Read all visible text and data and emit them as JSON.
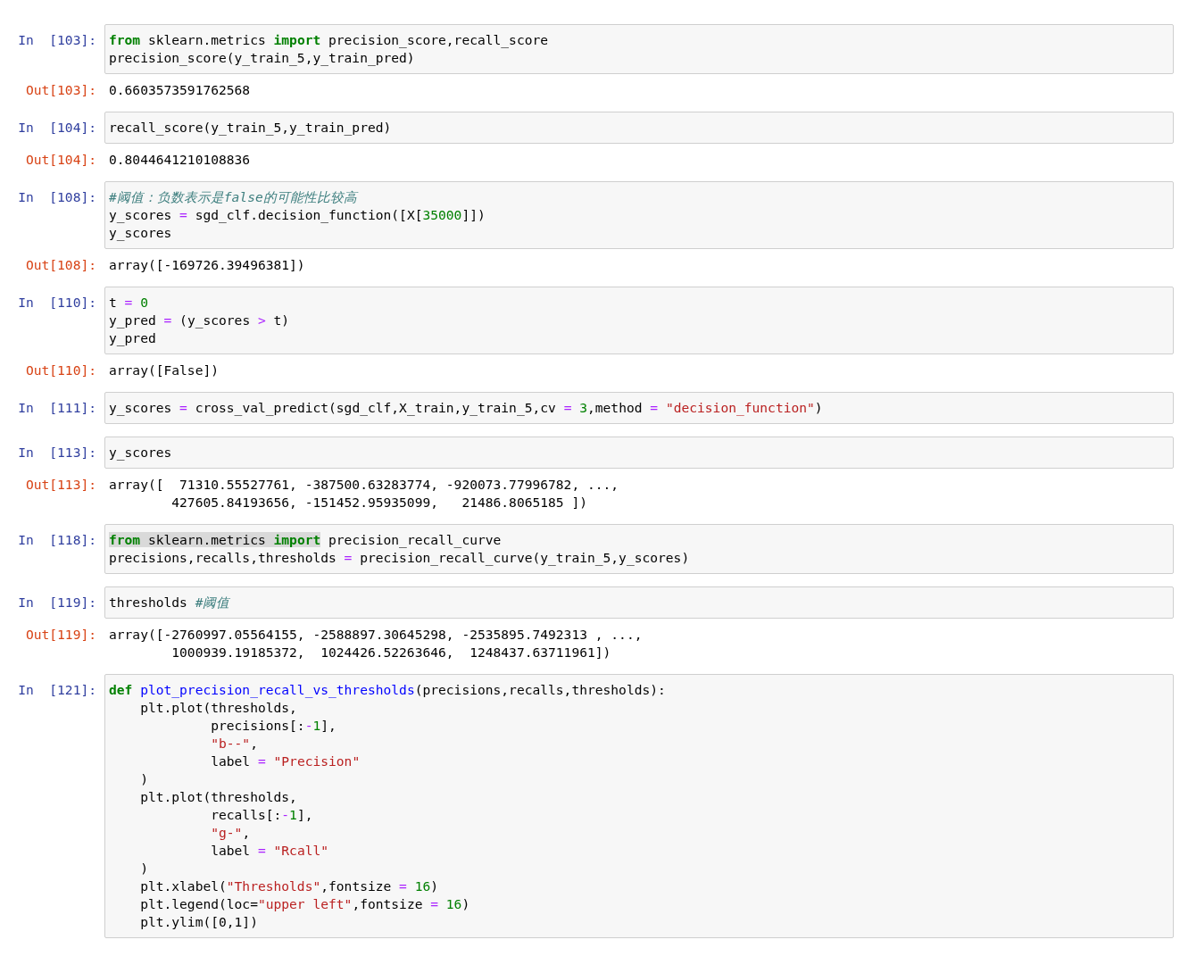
{
  "cells": [
    {
      "prompt": "In  [103]:",
      "lines": [
        [
          {
            "kind": "kw",
            "t": "from"
          },
          {
            "kind": "plain",
            "t": " sklearn.metrics "
          },
          {
            "kind": "kw",
            "t": "import"
          },
          {
            "kind": "plain",
            "t": " precision_score,recall_score"
          }
        ],
        [
          {
            "kind": "plain",
            "t": "precision_score(y_train_5,y_train_pred)"
          }
        ]
      ],
      "out_prompt": "Out[103]:",
      "output": [
        "0.6603573591762568"
      ]
    },
    {
      "prompt": "In  [104]:",
      "lines": [
        [
          {
            "kind": "plain",
            "t": "recall_score(y_train_5,y_train_pred)"
          }
        ]
      ],
      "out_prompt": "Out[104]:",
      "output": [
        "0.8044641210108836"
      ]
    },
    {
      "prompt": "In  [108]:",
      "lines": [
        [
          {
            "kind": "cm",
            "t": "#阈值：负数表示是false的可能性比较高"
          }
        ],
        [
          {
            "kind": "plain",
            "t": "y_scores "
          },
          {
            "kind": "op",
            "t": "="
          },
          {
            "kind": "plain",
            "t": " sgd_clf.decision_function([X["
          },
          {
            "kind": "num",
            "t": "35000"
          },
          {
            "kind": "plain",
            "t": "]])"
          }
        ],
        [
          {
            "kind": "plain",
            "t": "y_scores"
          }
        ]
      ],
      "out_prompt": "Out[108]:",
      "output": [
        "array([-169726.39496381])"
      ]
    },
    {
      "prompt": "In  [110]:",
      "lines": [
        [
          {
            "kind": "plain",
            "t": "t "
          },
          {
            "kind": "op",
            "t": "="
          },
          {
            "kind": "num",
            "t": " 0"
          }
        ],
        [
          {
            "kind": "plain",
            "t": "y_pred "
          },
          {
            "kind": "op",
            "t": "="
          },
          {
            "kind": "plain",
            "t": " (y_scores "
          },
          {
            "kind": "op",
            "t": ">"
          },
          {
            "kind": "plain",
            "t": " t)"
          }
        ],
        [
          {
            "kind": "plain",
            "t": "y_pred"
          }
        ]
      ],
      "out_prompt": "Out[110]:",
      "output": [
        "array([False])"
      ]
    },
    {
      "prompt": "In  [111]:",
      "lines": [
        [
          {
            "kind": "plain",
            "t": "y_scores "
          },
          {
            "kind": "op",
            "t": "="
          },
          {
            "kind": "plain",
            "t": " cross_val_predict(sgd_clf,X_train,y_train_5,cv "
          },
          {
            "kind": "op",
            "t": "="
          },
          {
            "kind": "num",
            "t": " 3"
          },
          {
            "kind": "plain",
            "t": ",method "
          },
          {
            "kind": "op",
            "t": "="
          },
          {
            "kind": "str",
            "t": " \"decision_function\""
          },
          {
            "kind": "plain",
            "t": ")"
          }
        ]
      ]
    },
    {
      "prompt": "In  [113]:",
      "lines": [
        [
          {
            "kind": "plain",
            "t": "y_scores"
          }
        ]
      ],
      "out_prompt": "Out[113]:",
      "output": [
        "array([  71310.55527761, -387500.63283774, -920073.77996782, ...,",
        "        427605.84193656, -151452.95935099,   21486.8065185 ])"
      ]
    },
    {
      "prompt": "In  [118]:",
      "lines": [
        [
          {
            "kind": "kw",
            "t": "from",
            "highlighted": true
          },
          {
            "kind": "plain",
            "t": " sklearn.metrics ",
            "highlighted": true
          },
          {
            "kind": "kw",
            "t": "import",
            "highlighted": true
          },
          {
            "kind": "plain",
            "t": " precision_recall_curve"
          }
        ],
        [
          {
            "kind": "plain",
            "t": "precisions,recalls,thresholds "
          },
          {
            "kind": "op",
            "t": "="
          },
          {
            "kind": "plain",
            "t": " precision_recall_curve(y_train_5,y_scores)"
          }
        ]
      ]
    },
    {
      "prompt": "In  [119]:",
      "lines": [
        [
          {
            "kind": "plain",
            "t": "thresholds"
          },
          {
            "kind": "cm",
            "t": " #阈值"
          }
        ]
      ],
      "out_prompt": "Out[119]:",
      "output": [
        "array([-2760997.05564155, -2588897.30645298, -2535895.7492313 , ...,",
        "        1000939.19185372,  1024426.52263646,  1248437.63711961])"
      ]
    },
    {
      "prompt": "In  [121]:",
      "lines": [
        [
          {
            "kind": "kw",
            "t": "def"
          },
          {
            "kind": "fn",
            "t": " plot_precision_recall_vs_thresholds"
          },
          {
            "kind": "plain",
            "t": "(precisions,recalls,thresholds):"
          }
        ],
        [
          {
            "kind": "plain",
            "t": "    plt.plot(thresholds,"
          }
        ],
        [
          {
            "kind": "plain",
            "t": "             precisions[:"
          },
          {
            "kind": "op",
            "t": "-"
          },
          {
            "kind": "num",
            "t": "1"
          },
          {
            "kind": "plain",
            "t": "],"
          }
        ],
        [
          {
            "kind": "str",
            "t": "             \"b--\""
          },
          {
            "kind": "plain",
            "t": ","
          }
        ],
        [
          {
            "kind": "plain",
            "t": "             label "
          },
          {
            "kind": "op",
            "t": "="
          },
          {
            "kind": "str",
            "t": " \"Precision\""
          }
        ],
        [
          {
            "kind": "plain",
            "t": "    )"
          }
        ],
        [
          {
            "kind": "plain",
            "t": "    plt.plot(thresholds,"
          }
        ],
        [
          {
            "kind": "plain",
            "t": "             recalls[:"
          },
          {
            "kind": "op",
            "t": "-"
          },
          {
            "kind": "num",
            "t": "1"
          },
          {
            "kind": "plain",
            "t": "],"
          }
        ],
        [
          {
            "kind": "str",
            "t": "             \"g-\""
          },
          {
            "kind": "plain",
            "t": ","
          }
        ],
        [
          {
            "kind": "plain",
            "t": "             label "
          },
          {
            "kind": "op",
            "t": "="
          },
          {
            "kind": "str",
            "t": " \"Rcall\""
          }
        ],
        [
          {
            "kind": "plain",
            "t": "    )"
          }
        ],
        [
          {
            "kind": "plain",
            "t": "    plt.xlabel("
          },
          {
            "kind": "str",
            "t": "\"Thresholds\""
          },
          {
            "kind": "plain",
            "t": ",fontsize "
          },
          {
            "kind": "op",
            "t": "="
          },
          {
            "kind": "num",
            "t": " 16"
          },
          {
            "kind": "plain",
            "t": ")"
          }
        ],
        [
          {
            "kind": "plain",
            "t": "    plt.legend(loc="
          },
          {
            "kind": "str",
            "t": "\"upper left\""
          },
          {
            "kind": "plain",
            "t": ",fontsize "
          },
          {
            "kind": "op",
            "t": "="
          },
          {
            "kind": "num",
            "t": " 16"
          },
          {
            "kind": "plain",
            "t": ")"
          }
        ],
        [
          {
            "kind": "plain",
            "t": "    plt.ylim([0,1])"
          }
        ]
      ]
    }
  ]
}
